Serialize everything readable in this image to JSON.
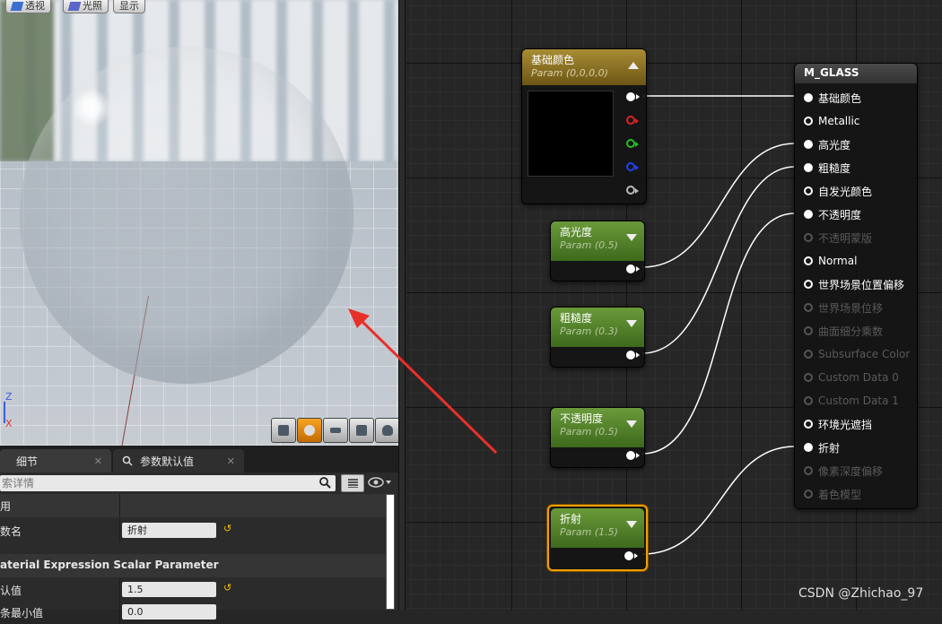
{
  "viewport": {
    "buttons": [
      {
        "label": "透视",
        "icon": "perspective-icon"
      },
      {
        "label": "光照",
        "icon": "lit-icon"
      },
      {
        "label": "显示"
      }
    ],
    "axis": {
      "z": "Z",
      "x": "X"
    },
    "view_modes": [
      "cylinder-preview-icon",
      "sphere-preview-icon",
      "plane-preview-icon",
      "cube-preview-icon",
      "teapot-preview-icon"
    ]
  },
  "details": {
    "tabs": [
      {
        "label": "细节",
        "close": "✕"
      },
      {
        "label": "参数默认值",
        "close": "✕"
      }
    ],
    "search_placeholder": "索详情",
    "sections": {
      "general": "用",
      "param_name_label": "数名",
      "param_name_value": "折射",
      "scalar_param_title": "aterial Expression Scalar Parameter",
      "default_label": "认值",
      "default_value": "1.5",
      "slider_min_label": "条最小值",
      "slider_min_value": "0.0"
    }
  },
  "graph": {
    "base_color_node": {
      "title": "基础颜色",
      "sub": "Param (0,0,0,0)",
      "preview_color": "#000000"
    },
    "scalar_nodes": [
      {
        "title": "高光度",
        "sub": "Param (0.5)"
      },
      {
        "title": "粗糙度",
        "sub": "Param (0.3)"
      },
      {
        "title": "不透明度",
        "sub": "Param (0.5)"
      },
      {
        "title": "折射",
        "sub": "Param (1.5)",
        "selected": true
      }
    ],
    "result_node": {
      "title": "M_GLASS",
      "pins": [
        {
          "label": "基础颜色",
          "enabled": true,
          "connected": true
        },
        {
          "label": "Metallic",
          "enabled": true,
          "connected": false
        },
        {
          "label": "高光度",
          "enabled": true,
          "connected": true
        },
        {
          "label": "粗糙度",
          "enabled": true,
          "connected": true
        },
        {
          "label": "自发光颜色",
          "enabled": true,
          "connected": false
        },
        {
          "label": "不透明度",
          "enabled": true,
          "connected": true
        },
        {
          "label": "不透明蒙版",
          "enabled": false,
          "connected": false
        },
        {
          "label": "Normal",
          "enabled": true,
          "connected": false
        },
        {
          "label": "世界场景位置偏移",
          "enabled": true,
          "connected": false
        },
        {
          "label": "世界场景位移",
          "enabled": false,
          "connected": false
        },
        {
          "label": "曲面细分乘数",
          "enabled": false,
          "connected": false
        },
        {
          "label": "Subsurface Color",
          "enabled": false,
          "connected": false
        },
        {
          "label": "Custom Data 0",
          "enabled": false,
          "connected": false
        },
        {
          "label": "Custom Data 1",
          "enabled": false,
          "connected": false
        },
        {
          "label": "环境光遮挡",
          "enabled": true,
          "connected": false
        },
        {
          "label": "折射",
          "enabled": true,
          "connected": true
        },
        {
          "label": "像素深度偏移",
          "enabled": false,
          "connected": false
        },
        {
          "label": "着色模型",
          "enabled": false,
          "connected": false
        }
      ]
    },
    "pin_colors": {
      "red": "#e02020",
      "green": "#20c020",
      "blue": "#2040ff",
      "alpha": "#bbbbbb"
    },
    "accent": "#f0a000"
  },
  "watermark": "CSDN @Zhichao_97",
  "annotation_color": "#e8302a"
}
